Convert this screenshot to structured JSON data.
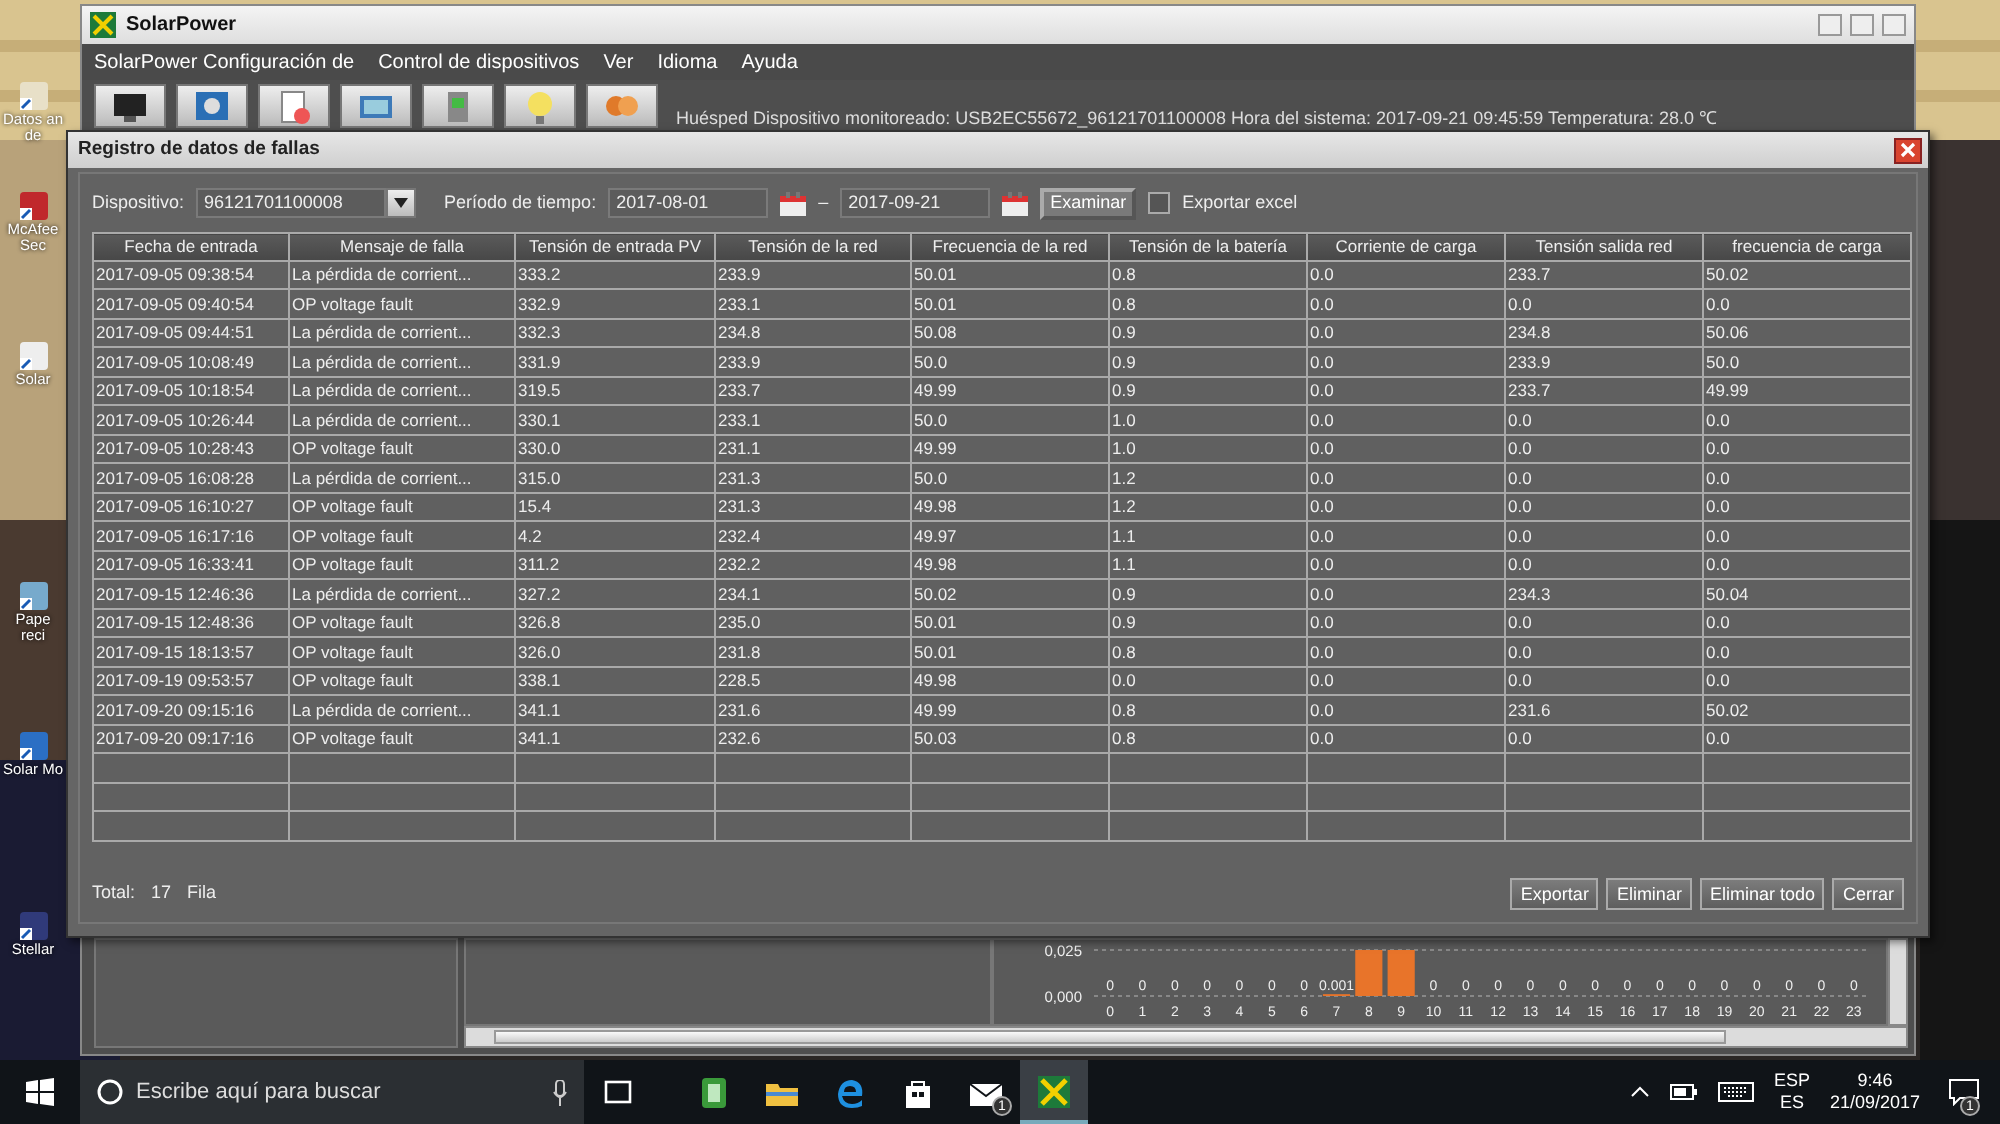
{
  "desktop_icons": [
    {
      "label": "Datos an de"
    },
    {
      "label": "McAfee Sec"
    },
    {
      "label": "Solar"
    },
    {
      "label": "Pape reci"
    },
    {
      "label": "Solar Mo"
    },
    {
      "label": "Stellar"
    }
  ],
  "main_window": {
    "title": "SolarPower",
    "menu": [
      "SolarPower Configuración de",
      "Control de dispositivos",
      "Ver",
      "Idioma",
      "Ayuda"
    ],
    "status": "Huésped   Dispositivo monitoreado: USB2EC55672_96121701100008   Hora del sistema: 2017-09-21 09:45:59   Temperatura: 28.0 ℃",
    "chart_data": {
      "type": "bar",
      "categories": [
        "0",
        "1",
        "2",
        "3",
        "4",
        "5",
        "6",
        "7",
        "8",
        "9",
        "10",
        "11",
        "12",
        "13",
        "14",
        "15",
        "16",
        "17",
        "18",
        "19",
        "20",
        "21",
        "22",
        "23"
      ],
      "series": [
        {
          "color": "#e8742a",
          "values": [
            0,
            0,
            0,
            0,
            0,
            0,
            0,
            0.001,
            0.025,
            0.025,
            0,
            0,
            0,
            0,
            0,
            0,
            0,
            0,
            0,
            0,
            0,
            0,
            0,
            0
          ]
        }
      ],
      "ylim": [
        0,
        0.025
      ],
      "yticks": [
        {
          "value": 0.025,
          "label": "0,025"
        },
        {
          "value": 0,
          "label": "0,000"
        }
      ],
      "value_labels": [
        "0",
        "0",
        "0",
        "0",
        "0",
        "0",
        "0",
        "0.001",
        null,
        null,
        "0",
        "0",
        "0",
        "0",
        "0",
        "0",
        "0",
        "0",
        "0",
        "0",
        "0",
        "0",
        "0",
        "0"
      ]
    }
  },
  "dialog": {
    "title": "Registro de datos de fallas",
    "device_label": "Dispositivo:",
    "device": "96121701100008",
    "period_label": "Período de tiempo:",
    "from": "2017-08-01",
    "separator": "–",
    "to": "2017-09-21",
    "search_button": "Examinar",
    "export_excel": {
      "label": "Exportar excel",
      "checked": false
    },
    "columns": [
      "Fecha de entrada",
      "Mensaje de falla",
      "Tensión de entrada PV",
      "Tensión de la red",
      "Frecuencia de la red",
      "Tensión de la batería",
      "Corriente de carga",
      "Tensión salida red",
      "frecuencia de carga"
    ],
    "rows": [
      [
        "2017-09-05 09:38:54",
        "La pérdida de corrient...",
        "333.2",
        "233.9",
        "50.01",
        "0.8",
        "0.0",
        "233.7",
        "50.02"
      ],
      [
        "2017-09-05 09:40:54",
        "OP voltage fault",
        "332.9",
        "233.1",
        "50.01",
        "0.8",
        "0.0",
        "0.0",
        "0.0"
      ],
      [
        "2017-09-05 09:44:51",
        "La pérdida de corrient...",
        "332.3",
        "234.8",
        "50.08",
        "0.9",
        "0.0",
        "234.8",
        "50.06"
      ],
      [
        "2017-09-05 10:08:49",
        "La pérdida de corrient...",
        "331.9",
        "233.9",
        "50.0",
        "0.9",
        "0.0",
        "233.9",
        "50.0"
      ],
      [
        "2017-09-05 10:18:54",
        "La pérdida de corrient...",
        "319.5",
        "233.7",
        "49.99",
        "0.9",
        "0.0",
        "233.7",
        "49.99"
      ],
      [
        "2017-09-05 10:26:44",
        "La pérdida de corrient...",
        "330.1",
        "233.1",
        "50.0",
        "1.0",
        "0.0",
        "0.0",
        "0.0"
      ],
      [
        "2017-09-05 10:28:43",
        "OP voltage fault",
        "330.0",
        "231.1",
        "49.99",
        "1.0",
        "0.0",
        "0.0",
        "0.0"
      ],
      [
        "2017-09-05 16:08:28",
        "La pérdida de corrient...",
        "315.0",
        "231.3",
        "50.0",
        "1.2",
        "0.0",
        "0.0",
        "0.0"
      ],
      [
        "2017-09-05 16:10:27",
        "OP voltage fault",
        "15.4",
        "231.3",
        "49.98",
        "1.2",
        "0.0",
        "0.0",
        "0.0"
      ],
      [
        "2017-09-05 16:17:16",
        "OP voltage fault",
        "4.2",
        "232.4",
        "49.97",
        "1.1",
        "0.0",
        "0.0",
        "0.0"
      ],
      [
        "2017-09-05 16:33:41",
        "OP voltage fault",
        "311.2",
        "232.2",
        "49.98",
        "1.1",
        "0.0",
        "0.0",
        "0.0"
      ],
      [
        "2017-09-15 12:46:36",
        "La pérdida de corrient...",
        "327.2",
        "234.1",
        "50.02",
        "0.9",
        "0.0",
        "234.3",
        "50.04"
      ],
      [
        "2017-09-15 12:48:36",
        "OP voltage fault",
        "326.8",
        "235.0",
        "50.01",
        "0.9",
        "0.0",
        "0.0",
        "0.0"
      ],
      [
        "2017-09-15 18:13:57",
        "OP voltage fault",
        "326.0",
        "231.8",
        "50.01",
        "0.8",
        "0.0",
        "0.0",
        "0.0"
      ],
      [
        "2017-09-19 09:53:57",
        "OP voltage fault",
        "338.1",
        "228.5",
        "49.98",
        "0.0",
        "0.0",
        "0.0",
        "0.0"
      ],
      [
        "2017-09-20 09:15:16",
        "La pérdida de corrient...",
        "341.1",
        "231.6",
        "49.99",
        "0.8",
        "0.0",
        "231.6",
        "50.02"
      ],
      [
        "2017-09-20 09:17:16",
        "OP voltage fault",
        "341.1",
        "232.6",
        "50.03",
        "0.8",
        "0.0",
        "0.0",
        "0.0"
      ]
    ],
    "total_label": "Total:",
    "total": "17",
    "total_unit": "Fila",
    "buttons": [
      "Exportar",
      "Eliminar",
      "Eliminar todo",
      "Cerrar"
    ]
  },
  "taskbar": {
    "search_placeholder": "Escribe aquí para buscar",
    "apps": [
      {
        "kind": "taskview",
        "active": false
      },
      {
        "kind": "notes",
        "active": false
      },
      {
        "kind": "folder",
        "active": false
      },
      {
        "kind": "browser",
        "active": false
      },
      {
        "kind": "store",
        "active": false
      },
      {
        "kind": "mail",
        "active": false,
        "badge": "1"
      },
      {
        "kind": "solar",
        "active": true
      }
    ],
    "language": "ESP",
    "layout": "ES",
    "time": "9:46",
    "date": "21/09/2017",
    "notifications": "1"
  }
}
